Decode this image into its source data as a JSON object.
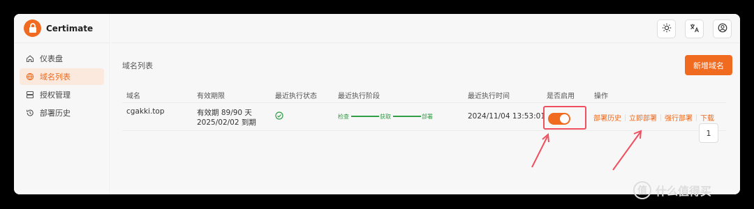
{
  "app": {
    "name": "Certimate"
  },
  "icons": {
    "logo": "lock-icon",
    "theme": "sun-icon",
    "language": "translate-icon",
    "account": "user-circle-icon",
    "enabled": "check-circle-icon"
  },
  "colors": {
    "accent": "#f06a1f",
    "success": "#2f9e44",
    "highlight_box": "#f04f5f"
  },
  "sidebar": {
    "items": [
      {
        "label": "仪表盘",
        "icon": "home-icon"
      },
      {
        "label": "域名列表",
        "icon": "globe-icon",
        "active": true
      },
      {
        "label": "授权管理",
        "icon": "server-icon"
      },
      {
        "label": "部署历史",
        "icon": "history-icon"
      }
    ]
  },
  "page": {
    "title": "域名列表",
    "add_button": "新增域名"
  },
  "table": {
    "headers": [
      "域名",
      "有效期限",
      "最近执行状态",
      "最近执行阶段",
      "最近执行时间",
      "是否启用",
      "操作"
    ],
    "rows": [
      {
        "domain": "cgakki.top",
        "validity_line1": "有效期 89/90 天",
        "validity_line2": "2025/02/02 到期",
        "stages": [
          "检查",
          "获取",
          "部署"
        ],
        "last_time": "2024/11/04 13:53:01",
        "enabled": true,
        "actions": [
          "部署历史",
          "立即部署",
          "强行部署",
          "下载"
        ]
      }
    ]
  },
  "pagination": {
    "current": "1"
  },
  "watermark": {
    "text": "什么值得买",
    "symbol": "值"
  }
}
